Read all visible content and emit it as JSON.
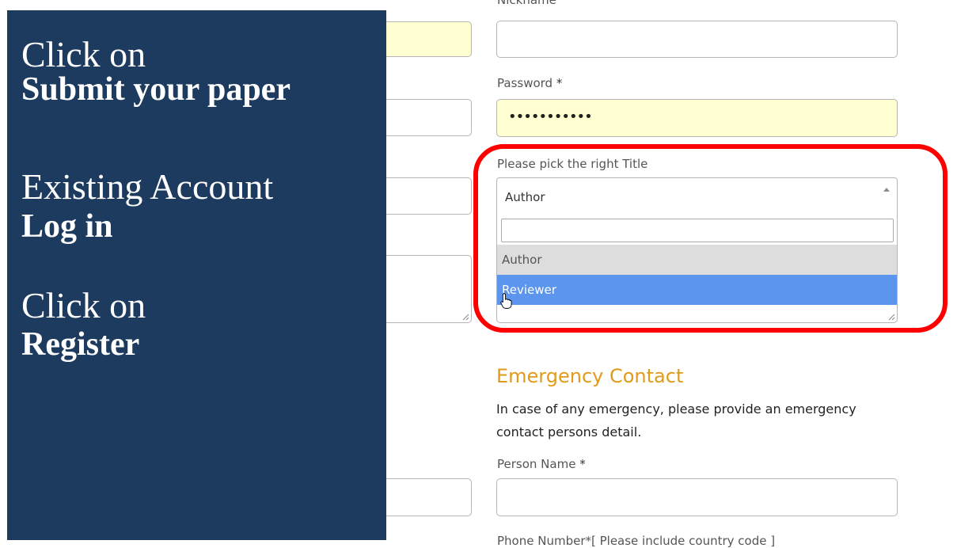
{
  "form": {
    "nickname_label": "Nickname",
    "password_label": "Password",
    "password_required": "*",
    "password_value": "•••••••••••",
    "title_label": "Please pick the right Title",
    "title_selected": "Author",
    "title_options": [
      "Author",
      "Reviewer"
    ],
    "search_placeholder": ""
  },
  "emergency": {
    "heading": "Emergency Contact",
    "description_line1": "In case of any emergency, please provide an emergency",
    "description_line2": "contact persons detail.",
    "person_name_label": "Person Name",
    "person_name_required": "*",
    "phone_label": "Phone Number*[ Please include country code ]"
  },
  "overlay": {
    "step1_line1": "Click on",
    "step1_line2": "Submit your paper",
    "step2_line1": "Existing Account",
    "step2_line2": "Log in",
    "step3_line1": "Click on",
    "step3_line2": "Register"
  },
  "colors": {
    "overlay_background": "#1d3a5f",
    "highlight_ring": "#ff0000",
    "selected_option": "#5b95ee",
    "hover_option": "#dddddd",
    "heading_accent": "#e09b1a",
    "autofill_yellow": "#ffffd2"
  }
}
